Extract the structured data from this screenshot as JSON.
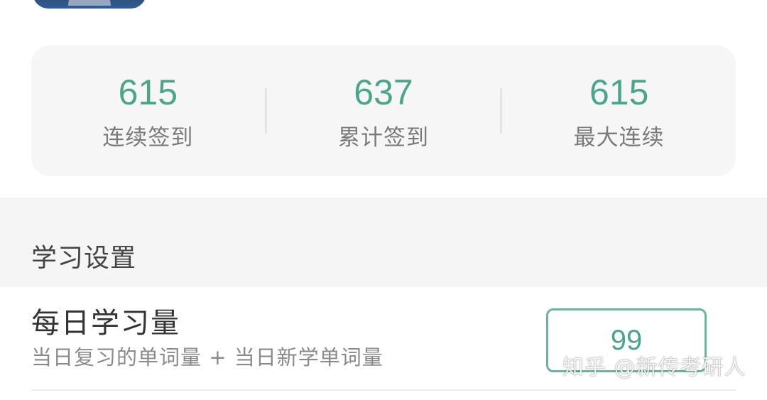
{
  "stats": [
    {
      "value": "615",
      "label": "连续签到"
    },
    {
      "value": "637",
      "label": "累计签到"
    },
    {
      "value": "615",
      "label": "最大连续"
    }
  ],
  "section": {
    "title": "学习设置"
  },
  "daily_setting": {
    "title": "每日学习量",
    "description": "当日复习的单词量 + 当日新学单词量",
    "value": "99"
  },
  "watermark": "知乎 @新传考研人",
  "colors": {
    "accent": "#4aa58a",
    "card_bg": "#f6f6f6",
    "section_bg": "#f5f5f5"
  }
}
